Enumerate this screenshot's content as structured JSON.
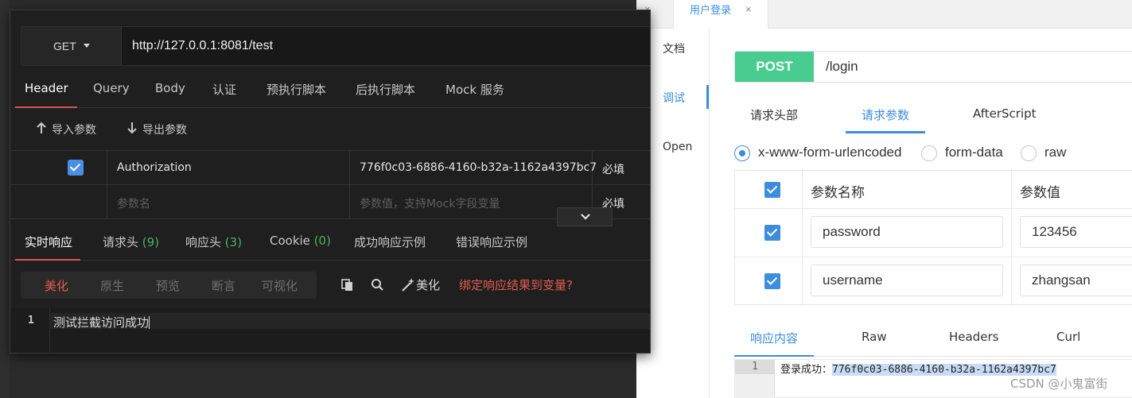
{
  "bg": {
    "top_tab": {
      "label": "用户登录",
      "close": "×"
    },
    "side": [
      {
        "label": "文档",
        "active": false
      },
      {
        "label": "调试",
        "active": true
      },
      {
        "label": "Open",
        "active": false
      }
    ],
    "method": "POST",
    "path": "/login",
    "req_tabs": [
      {
        "label": "请求头部",
        "active": false
      },
      {
        "label": "请求参数",
        "active": true
      },
      {
        "label": "AfterScript",
        "active": false
      }
    ],
    "body_types": [
      {
        "label": "x-www-form-urlencoded",
        "selected": true
      },
      {
        "label": "form-data",
        "selected": false
      },
      {
        "label": "raw",
        "selected": false
      }
    ],
    "params_header": {
      "name": "参数名称",
      "value": "参数值"
    },
    "params": [
      {
        "checked": true,
        "name": "password",
        "value": "123456"
      },
      {
        "checked": true,
        "name": "username",
        "value": "zhangsan"
      }
    ],
    "resp_tabs": [
      {
        "label": "响应内容",
        "active": true
      },
      {
        "label": "Raw",
        "active": false
      },
      {
        "label": "Headers",
        "active": false
      },
      {
        "label": "Curl",
        "active": false
      }
    ],
    "resp_line_no": "1",
    "resp_prefix": "登录成功：",
    "resp_token": "776f0c03-6886-4160-b32a-1162a4397bc7",
    "watermark": "CSDN @小鬼富街"
  },
  "fg": {
    "method": "GET",
    "url": "http://127.0.0.1:8081/test",
    "tabs": [
      {
        "label": "Header",
        "active": true
      },
      {
        "label": "Query",
        "active": false
      },
      {
        "label": "Body",
        "active": false
      },
      {
        "label": "认证",
        "active": false
      },
      {
        "label": "预执行脚本",
        "active": false
      },
      {
        "label": "后执行脚本",
        "active": false
      },
      {
        "label": "Mock 服务",
        "active": false
      }
    ],
    "import_label": "导入参数",
    "export_label": "导出参数",
    "header_rows": [
      {
        "checked": true,
        "key": "Authorization",
        "value": "776f0c03-6886-4160-b32a-1162a4397bc7",
        "required": "必填"
      }
    ],
    "new_row": {
      "key_placeholder": "参数名",
      "value_placeholder": "参数值，支持Mock字段变量",
      "required": "必填"
    },
    "resp_tabs": [
      {
        "label": "实时响应",
        "count": "",
        "active": true
      },
      {
        "label": "请求头",
        "count": "(9)",
        "active": false
      },
      {
        "label": "响应头",
        "count": "(3)",
        "active": false
      },
      {
        "label": "Cookie",
        "count": "(0)",
        "active": false
      },
      {
        "label": "成功响应示例",
        "count": "",
        "active": false
      },
      {
        "label": "错误响应示例",
        "count": "",
        "active": false
      }
    ],
    "view_modes": [
      {
        "label": "美化",
        "active": true
      },
      {
        "label": "原生",
        "active": false
      },
      {
        "label": "预览",
        "active": false
      },
      {
        "label": "断言",
        "active": false
      },
      {
        "label": "可视化",
        "active": false
      }
    ],
    "beautify_label": "美化",
    "bind_link": "绑定响应结果到变量?",
    "line_no": "1",
    "response_text": "测试拦截访问成功"
  },
  "colors": {
    "accent_blue": "#3c8dde",
    "post_green": "#49cc90",
    "dark_accent_red": "#e35b4f",
    "count_green": "#4caf6a"
  }
}
